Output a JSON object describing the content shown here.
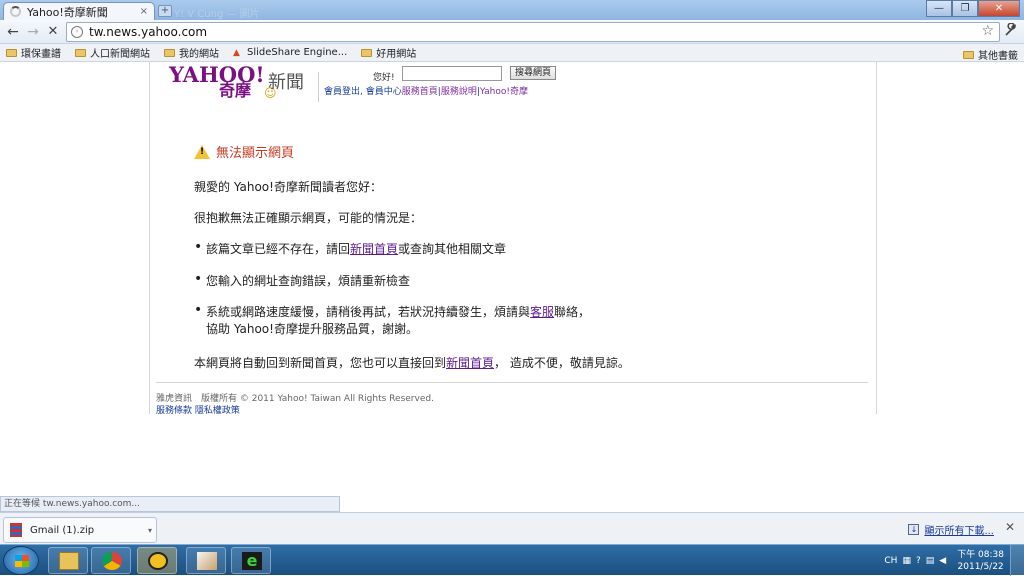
{
  "browser": {
    "tab_title": "Yahoo!奇摩新聞",
    "tab_close": "×",
    "new_tab": "+",
    "ghost_tab": "Y! V Cung — 圖片",
    "url": "tw.news.yahoo.com",
    "back": "←",
    "forward": "→",
    "stop": "✕",
    "star": "☆",
    "wrench": "🔧",
    "win_minimize": "—",
    "win_restore": "❐",
    "win_close": "✕"
  },
  "bookmarks": {
    "items": [
      {
        "label": "環保畫譜",
        "icon": "folder-icon"
      },
      {
        "label": "人口新聞網站",
        "icon": "folder-icon"
      },
      {
        "label": "我的網站",
        "icon": "folder-icon"
      },
      {
        "label": "SlideShare Engine...",
        "icon": "slideshare-icon"
      },
      {
        "label": "好用網站",
        "icon": "folder-icon"
      }
    ],
    "other": "其他書籤"
  },
  "page": {
    "logo_yahoo": "YAHOO!",
    "logo_cn": "奇摩",
    "logo_news": "新聞",
    "greeting": "您好!",
    "search_button": "搜尋網頁",
    "links": {
      "signout": "會員登出",
      "comma": ", ",
      "member_center": "會員中心",
      "service_home": "服務首頁",
      "service_desc": "服務說明",
      "yahoo_qimo": "Yahoo!奇摩",
      "divider": "|"
    },
    "error_title": "無法顯示網頁",
    "greeting_line": "親愛的 Yahoo!奇摩新聞讀者您好：",
    "apology": "很抱歉無法正確顯示網頁，可能的情況是：",
    "bullet_dot": "•",
    "bullet1_pre": "該篇文章已經不存在，請回",
    "bullet1_link": "新聞首頁",
    "bullet1_post": "或查詢其他相關文章",
    "bullet2": "您輸入的網址查詢錯誤，煩請重新檢查",
    "bullet3_pre": "系統或網路速度緩慢，請稍後再試，若狀況持續發生，煩請與",
    "bullet3_link": "客服",
    "bullet3_post": "聯絡，",
    "bullet3_line2": "協助 Yahoo!奇摩提升服務品質，謝謝。",
    "redirect_pre": "本網頁將自動回到新聞首頁，您也可以直接回到",
    "redirect_link": "新聞首頁",
    "redirect_post": "， 造成不便，敬請見諒。",
    "footer_copyright": "雅虎資訊　版權所有 © 2011 Yahoo! Taiwan All Rights Reserved.",
    "footer_terms": "服務條款",
    "footer_privacy": "隱私權政策"
  },
  "status_bar": "正在等候 tw.news.yahoo.com...",
  "downloads": {
    "file": "Gmail (1).zip",
    "arrow": "▾",
    "show_all": "顯示所有下載...",
    "close": "✕"
  },
  "taskbar": {
    "lang": "CH",
    "time": "下午 08:38",
    "date": "2011/5/22"
  },
  "colors": {
    "yahoo_purple": "#7b0f84",
    "error_red": "#c43b22",
    "link_blue": "#1a3c9a",
    "visited_purple": "#5b1d8a"
  }
}
